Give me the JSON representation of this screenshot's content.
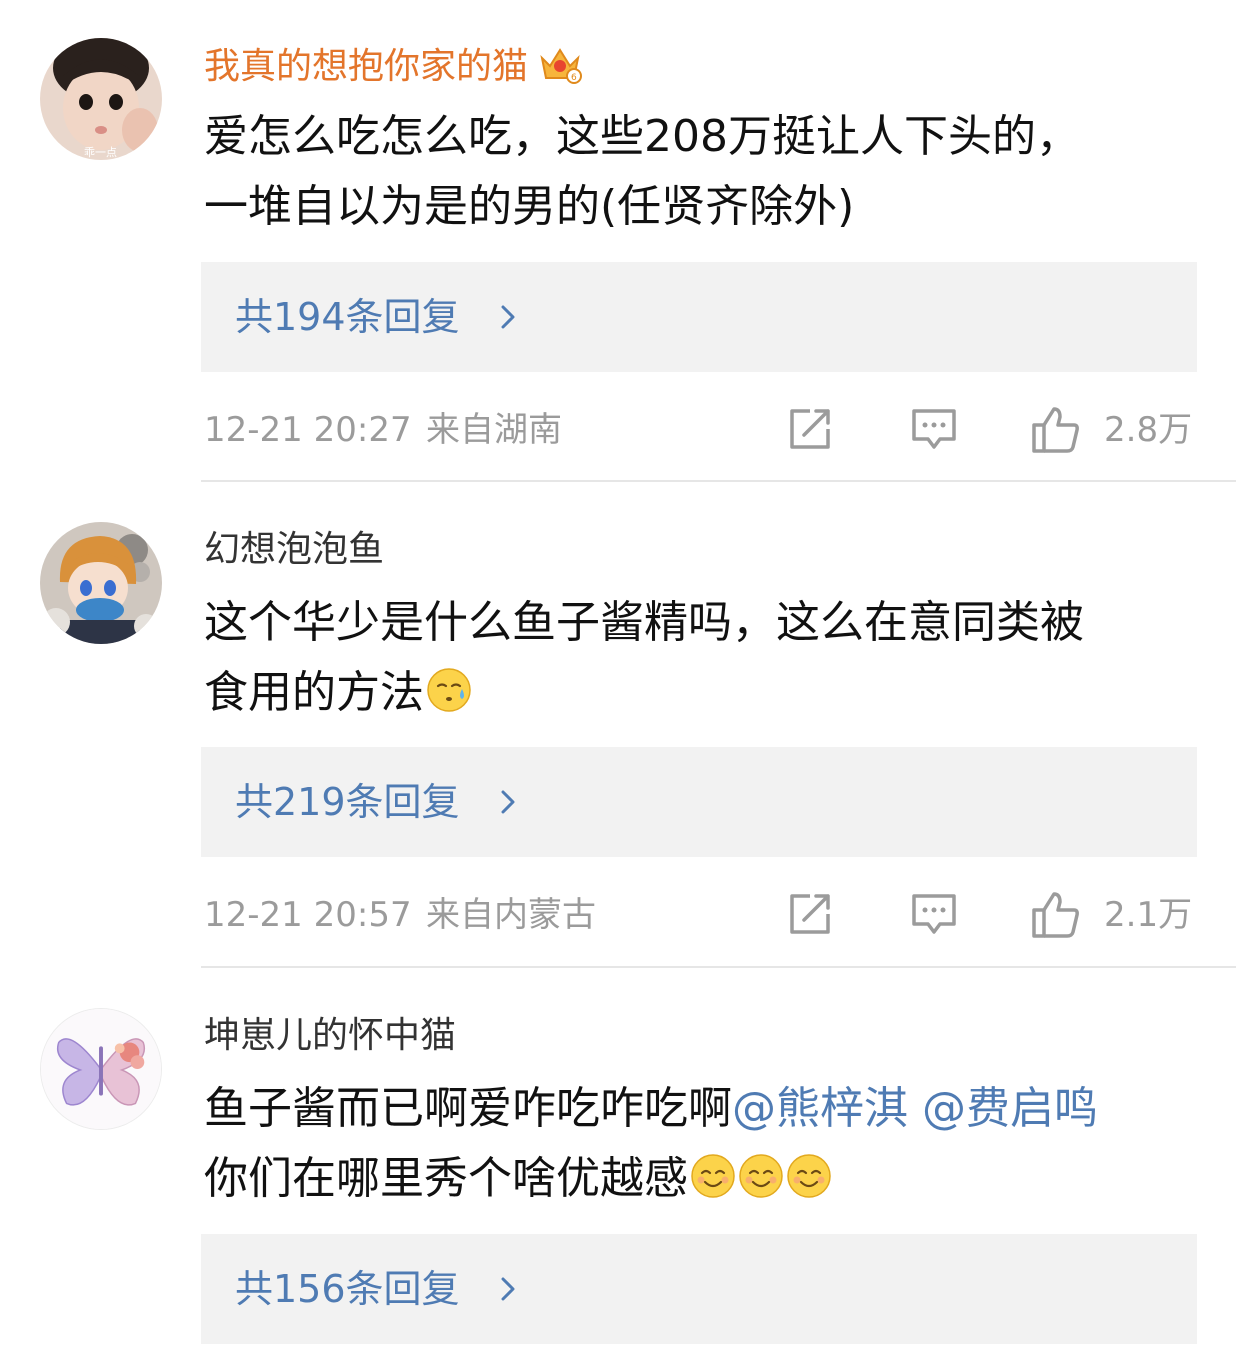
{
  "comments": [
    {
      "username": "我真的想抱你家的猫",
      "is_vip": true,
      "text_lines": [
        "爱怎么吃怎么吃，这些208万挺让人下头的，",
        "一堆自以为是的男的(任贤齐除外)"
      ],
      "replies_label": "共194条回复",
      "time": "12-21 20:27",
      "location": "来自湖南",
      "likes": "2.8万",
      "avatar_icon": "child-photo-avatar"
    },
    {
      "username": "幻想泡泡鱼",
      "is_vip": false,
      "text_lines": [
        "这个华少是什么鱼子酱精吗，这么在意同类被",
        "食用的方法"
      ],
      "emoji": "sweat-face-emoji",
      "replies_label": "共219条回复",
      "time": "12-21 20:57",
      "location": "来自内蒙古",
      "likes": "2.1万",
      "avatar_icon": "anime-boy-avatar"
    },
    {
      "username": "坤崽儿的怀中猫",
      "is_vip": false,
      "text_line1_plain": "鱼子酱而已啊爱咋吃咋吃啊",
      "mention1": "@熊梓淇",
      "mention2": "@费启鸣",
      "text_line2": "你们在哪里秀个啥优越感",
      "emoji": "smile-face-emoji",
      "replies_label": "共156条回复",
      "avatar_icon": "butterfly-avatar"
    }
  ],
  "colors": {
    "vip_name": "#e3752b",
    "link_blue": "#4f7bb3",
    "meta_gray": "#9b9b9b",
    "reply_bg": "#f2f2f2"
  }
}
